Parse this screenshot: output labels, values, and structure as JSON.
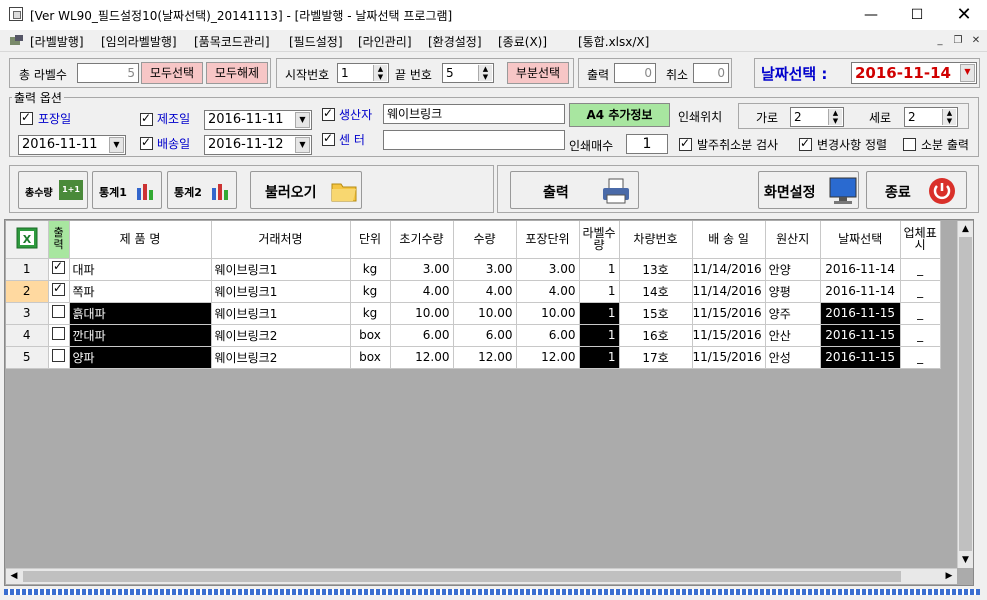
{
  "window": {
    "title": "[Ver WL90_필드설정10(날짜선택)_20141113] - [라벨발행 - 날짜선택 프로그램]"
  },
  "menu": [
    "[라벨발행]",
    "[임의라벨발행]",
    "[품목코드관리]",
    "[필드설정]",
    "[라인관리]",
    "[환경설정]",
    "[종료(X)]",
    "[통합.xlsx/X]"
  ],
  "top": {
    "total_label": "총 라벨수",
    "total_value": "5",
    "select_all": "모두선택",
    "deselect_all": "모두해제",
    "start_no_label": "시작번호",
    "start_no": "1",
    "end_no_label": "끝 번호",
    "end_no": "5",
    "partial_select": "부분선택",
    "print_label": "출력",
    "print_value": "0",
    "cancel_label": "취소",
    "cancel_value": "0",
    "date_select_label": "날짜선택 :",
    "date_select_value": "2016-11-14"
  },
  "options": {
    "group_title": "출력 옵션",
    "package_label": "포장일",
    "package_date": "2016-11-11",
    "manufacture_label": "제조일",
    "manufacture_date": "2016-11-11",
    "delivery_label": "배송일",
    "delivery_date": "2016-11-12",
    "producer_label": "생산자",
    "producer_value": "웨이브링크",
    "center_label": "센 터",
    "center_value": "",
    "a4_button": "A4 추가정보",
    "print_pos_label": "인쇄위치",
    "horizontal_label": "가로",
    "horizontal_value": "2",
    "vertical_label": "세로",
    "vertical_value": "2",
    "copies_label": "인쇄매수",
    "copies_value": "1",
    "check_order_cancel": "발주취소분 검사",
    "check_change_sort": "변경사항 정렬",
    "check_small_print": "소분 출력"
  },
  "toolbar": {
    "btn1": "총수량",
    "btn1_badge": "1+1",
    "btn2": "통계1",
    "btn3": "통계2",
    "load": "불러오기",
    "print": "출력",
    "screen": "화면설정",
    "exit": "종료"
  },
  "grid": {
    "headers": [
      "출력",
      "제 품 명",
      "거래처명",
      "단위",
      "초기수량",
      "수량",
      "포장단위",
      "라벨수량",
      "차량번호",
      "배 송 일",
      "원산지",
      "날짜선택",
      "업체표시"
    ],
    "rows": [
      {
        "no": "1",
        "check": true,
        "product": "대파",
        "client": "웨이브링크1",
        "unit": "kg",
        "init_qty": "3.00",
        "qty": "3.00",
        "pack": "3.00",
        "labels": "1",
        "car": "13호",
        "ship": "11/14/2016",
        "origin": "안양",
        "date": "2016-11-14",
        "mark": "_"
      },
      {
        "no": "2",
        "check": true,
        "product": "쪽파",
        "client": "웨이브링크1",
        "unit": "kg",
        "init_qty": "4.00",
        "qty": "4.00",
        "pack": "4.00",
        "labels": "1",
        "car": "14호",
        "ship": "11/14/2016",
        "origin": "양평",
        "date": "2016-11-14",
        "mark": "_"
      },
      {
        "no": "3",
        "check": false,
        "product": "흙대파",
        "client": "웨이브링크1",
        "unit": "kg",
        "init_qty": "10.00",
        "qty": "10.00",
        "pack": "10.00",
        "labels": "1",
        "car": "15호",
        "ship": "11/15/2016",
        "origin": "양주",
        "date": "2016-11-15",
        "mark": "_"
      },
      {
        "no": "4",
        "check": false,
        "product": "깐대파",
        "client": "웨이브링크2",
        "unit": "box",
        "init_qty": "6.00",
        "qty": "6.00",
        "pack": "6.00",
        "labels": "1",
        "car": "16호",
        "ship": "11/15/2016",
        "origin": "안산",
        "date": "2016-11-15",
        "mark": "_"
      },
      {
        "no": "5",
        "check": false,
        "product": "양파",
        "client": "웨이브링크2",
        "unit": "box",
        "init_qty": "12.00",
        "qty": "12.00",
        "pack": "12.00",
        "labels": "1",
        "car": "17호",
        "ship": "11/15/2016",
        "origin": "안성",
        "date": "2016-11-15",
        "mark": "_"
      }
    ]
  },
  "colors": {
    "pink": "#f7c6c6",
    "green": "#a8e6a0",
    "date_text": "#d00000",
    "label_blue": "#0000cc",
    "selected_row": "#ffd9a0"
  },
  "icons": [
    "app-icon",
    "excel-icon",
    "printer-icon",
    "folder-icon",
    "monitor-icon",
    "power-icon",
    "bar-chart-icon"
  ]
}
